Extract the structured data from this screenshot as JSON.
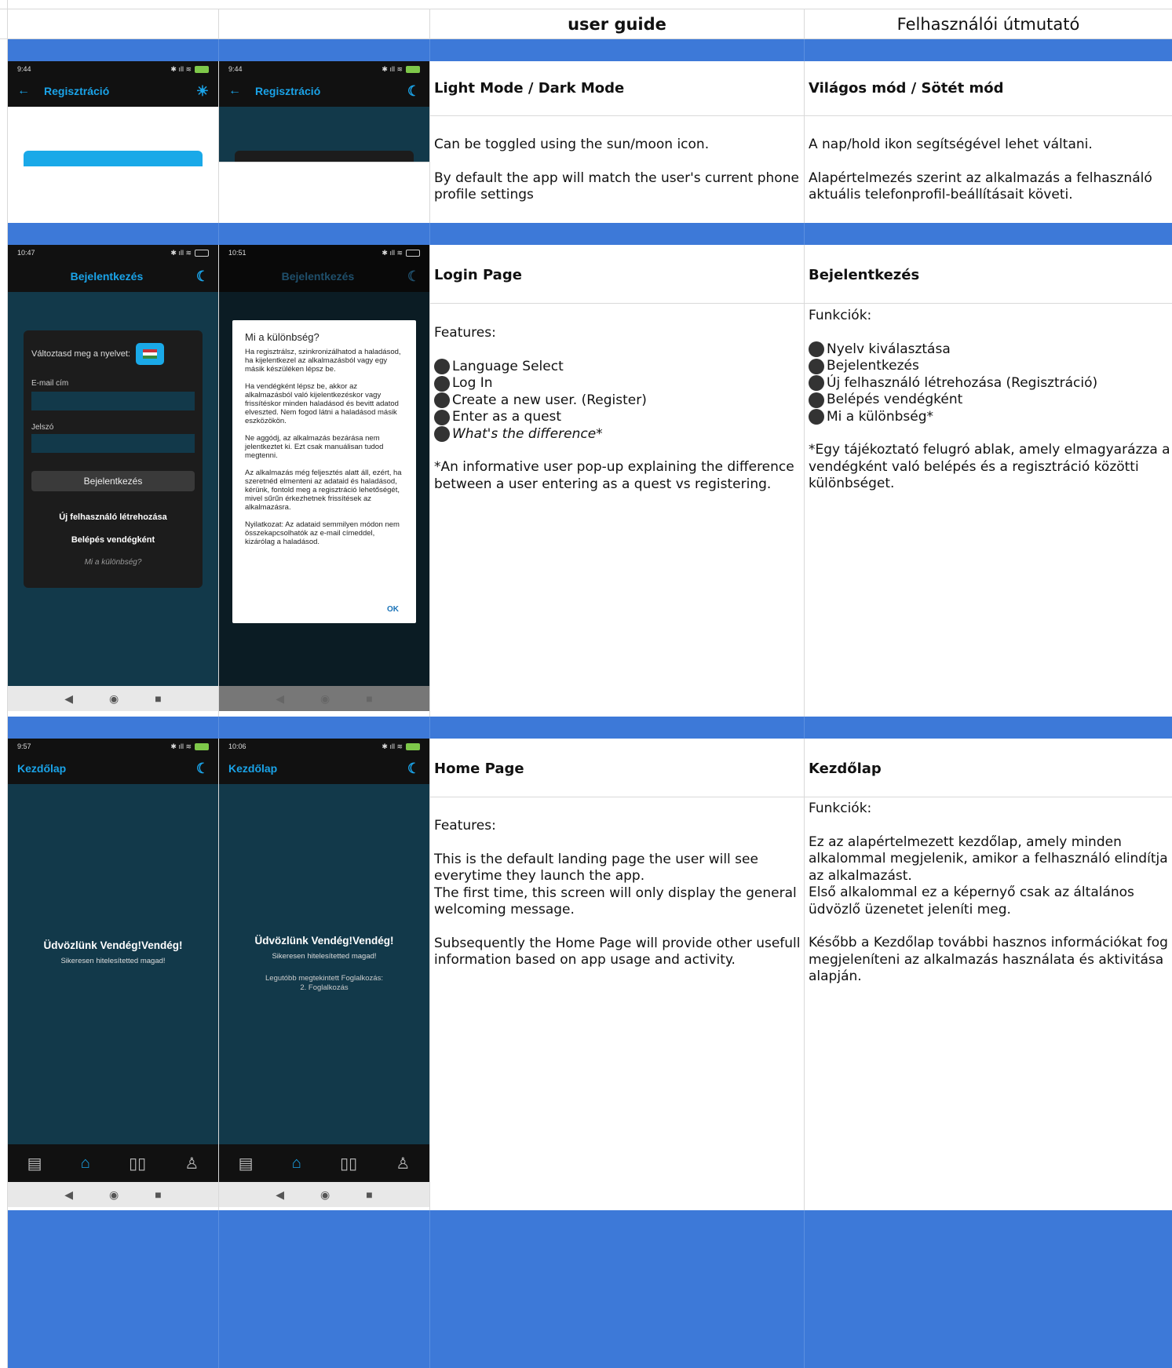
{
  "header": {
    "en_title": "user guide",
    "hu_title": "Felhasználói útmutató"
  },
  "row1": {
    "title_en": "Light Mode / Dark Mode",
    "title_hu": "Világos mód / Sötét mód",
    "text_en_1": "Can be toggled using the sun/moon icon.",
    "text_en_2": "By default the app will match the user's current phone profile settings",
    "text_hu_1": "A nap/hold ikon segítségével lehet váltani.",
    "text_hu_2": "Alapértelmezés szerint az alkalmazás a felhasználó aktuális telefonprofil-beállításait követi.",
    "phone_left": {
      "time": "9:44",
      "title": "Regisztráció",
      "icon": "sun-icon"
    },
    "phone_right": {
      "time": "9:44",
      "title": "Regisztráció",
      "icon": "moon-icon"
    }
  },
  "row2": {
    "title_en": "Login Page",
    "title_hu": "Bejelentkezés",
    "features_en": "Features:",
    "bullets_en": [
      "Language Select",
      "Log In",
      "Create a new user. (Register)",
      "Enter as a quest",
      "What's the difference*"
    ],
    "note_en": "*An informative user pop-up explaining the difference between a user entering as a quest vs registering.",
    "features_hu": "Funkciók:",
    "bullets_hu": [
      "Nyelv kiválasztása",
      "Bejelentkezés",
      "Új felhasználó létrehozása (Regisztráció)",
      "Belépés vendégként",
      "Mi a különbség*"
    ],
    "note_hu": "*Egy tájékoztató felugró ablak, amely elmagyarázza a vendégként való belépés és a regisztráció közötti különbséget.",
    "phone_left": {
      "time": "10:47",
      "title": "Bejelentkezés",
      "lang_label": "Változtasd meg a nyelvet:",
      "email_label": "E-mail cím",
      "password_label": "Jelszó",
      "login_button": "Bejelentkezés",
      "register_link": "Új felhasználó létrehozása",
      "guest_link": "Belépés vendégként",
      "difference_link": "Mi a különbség?"
    },
    "phone_right": {
      "time": "10:51",
      "title": "Bejelentkezés",
      "dialog_title": "Mi a különbség?",
      "dialog_p1": "Ha regisztrálsz, szinkronizálhatod a haladásod, ha kijelentkezel az alkalmazásból vagy egy másik készüléken lépsz be.",
      "dialog_p2": "Ha vendégként lépsz be, akkor az alkalmazásból való kijelentkezéskor vagy frissítéskor minden haladásod és bevitt adatod elveszted. Nem fogod látni a haladásod másik eszközökön.",
      "dialog_p3": "Ne aggódj, az alkalmazás bezárása nem jelentkeztet ki. Ezt csak manuálisan tudod megtenni.",
      "dialog_p4": "Az alkalmazás még feljesztés alatt áll, ezért, ha szeretnéd elmenteni az adataid és haladásod, kérünk, fontold meg a regisztráció lehetőségét, mivel sűrűn érkezhetnek frissítések az alkalmazásra.",
      "dialog_p5": "Nyilatkozat: Az adataid semmilyen módon nem összekapcsolhatók az e-mail címeddel, kizárólag a haladásod.",
      "dialog_ok": "OK"
    }
  },
  "row3": {
    "title_en": "Home Page",
    "title_hu": "Kezdőlap",
    "features_en": "Features:",
    "text_en_1": "This is the default landing page the user will see everytime they launch the app.",
    "text_en_2": "The first time, this screen will only display the general welcoming message.",
    "text_en_3": "Subsequently the Home Page will provide other usefull information based on app usage and activity.",
    "features_hu": "Funkciók:",
    "text_hu_1": "Ez az alapértelmezett kezdőlap, amely minden alkalommal megjelenik, amikor a felhasználó elindítja az alkalmazást.",
    "text_hu_2": "Első alkalommal ez a képernyő csak az általános üdvözlő üzenetet jeleníti meg.",
    "text_hu_3": "Később a Kezdőlap további hasznos információkat fog megjeleníteni az alkalmazás használata és aktivitása alapján.",
    "phone_left": {
      "time": "9:57",
      "title": "Kezdőlap",
      "welcome": "Üdvözlünk Vendég!Vendég!",
      "auth_msg": "Sikeresen hitelesítetted magad!"
    },
    "phone_right": {
      "time": "10:06",
      "title": "Kezdőlap",
      "welcome": "Üdvözlünk Vendég!Vendég!",
      "auth_msg": "Sikeresen hitelesítetted magad!",
      "recent_label": "Legutóbb megtekintett Foglalkozás:",
      "recent_value": "2. Foglalkozás"
    }
  },
  "colors": {
    "band": "#3d79d8",
    "accent": "#1aa3e8",
    "dark_teal": "#12394a"
  }
}
